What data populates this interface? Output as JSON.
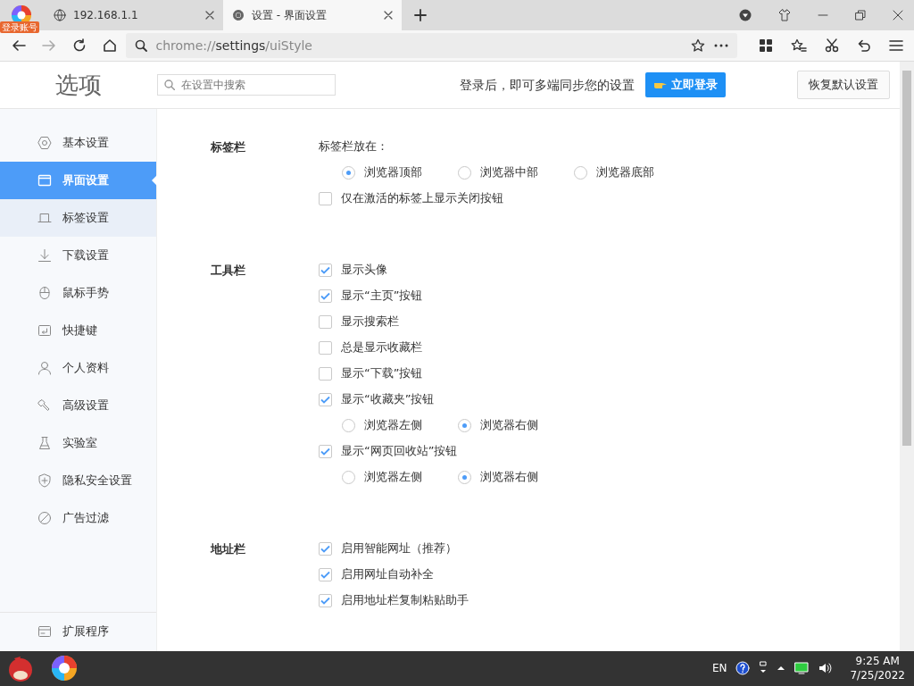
{
  "browser": {
    "account_badge": "登录账号",
    "tabs": [
      {
        "title": "192.168.1.1",
        "selected": false
      },
      {
        "title": "设置 - 界面设置",
        "selected": true
      }
    ],
    "url": {
      "scheme": "chrome://",
      "host": "settings",
      "path": "/uiStyle"
    }
  },
  "header": {
    "title": "选项",
    "search": {
      "placeholder": "在设置中搜索"
    },
    "sync_text": "登录后，即可多端同步您的设置",
    "login_button": "立即登录",
    "reset_button": "恢复默认设置"
  },
  "sidebar": {
    "items": [
      {
        "label": "基本设置",
        "selected": false,
        "hovered": false
      },
      {
        "label": "界面设置",
        "selected": true,
        "hovered": false
      },
      {
        "label": "标签设置",
        "selected": false,
        "hovered": true
      },
      {
        "label": "下载设置",
        "selected": false,
        "hovered": false
      },
      {
        "label": "鼠标手势",
        "selected": false,
        "hovered": false
      },
      {
        "label": "快捷键",
        "selected": false,
        "hovered": false
      },
      {
        "label": "个人资料",
        "selected": false,
        "hovered": false
      },
      {
        "label": "高级设置",
        "selected": false,
        "hovered": false
      },
      {
        "label": "实验室",
        "selected": false,
        "hovered": false
      },
      {
        "label": "隐私安全设置",
        "selected": false,
        "hovered": false
      },
      {
        "label": "广告过滤",
        "selected": false,
        "hovered": false
      }
    ],
    "footer_item": "扩展程序"
  },
  "sections": [
    {
      "title": "标签栏",
      "items": [
        {
          "kind": "label",
          "text": "标签栏放在："
        },
        {
          "kind": "radios",
          "options": [
            {
              "label": "浏览器顶部",
              "selected": true
            },
            {
              "label": "浏览器中部",
              "selected": false
            },
            {
              "label": "浏览器底部",
              "selected": false
            }
          ]
        },
        {
          "kind": "checkbox",
          "label": "仅在激活的标签上显示关闭按钮",
          "checked": false
        }
      ]
    },
    {
      "title": "工具栏",
      "items": [
        {
          "kind": "checkbox",
          "label": "显示头像",
          "checked": true
        },
        {
          "kind": "checkbox",
          "label": "显示“主页”按钮",
          "checked": true
        },
        {
          "kind": "checkbox",
          "label": "显示搜索栏",
          "checked": false
        },
        {
          "kind": "checkbox",
          "label": "总是显示收藏栏",
          "checked": false
        },
        {
          "kind": "checkbox",
          "label": "显示“下载”按钮",
          "checked": false
        },
        {
          "kind": "checkbox",
          "label": "显示“收藏夹”按钮",
          "checked": true
        },
        {
          "kind": "radios",
          "options": [
            {
              "label": "浏览器左侧",
              "selected": false
            },
            {
              "label": "浏览器右侧",
              "selected": true
            }
          ]
        },
        {
          "kind": "checkbox",
          "label": "显示“网页回收站”按钮",
          "checked": true
        },
        {
          "kind": "radios",
          "options": [
            {
              "label": "浏览器左侧",
              "selected": false
            },
            {
              "label": "浏览器右侧",
              "selected": true
            }
          ]
        }
      ]
    },
    {
      "title": "地址栏",
      "items": [
        {
          "kind": "checkbox",
          "label": "启用智能网址（推荐）",
          "checked": true
        },
        {
          "kind": "checkbox",
          "label": "启用网址自动补全",
          "checked": true
        },
        {
          "kind": "checkbox",
          "label": "启用地址栏复制粘贴助手",
          "checked": true
        }
      ]
    }
  ],
  "taskbar": {
    "language": "EN",
    "time": "9:25 AM",
    "date": "7/25/2022"
  }
}
